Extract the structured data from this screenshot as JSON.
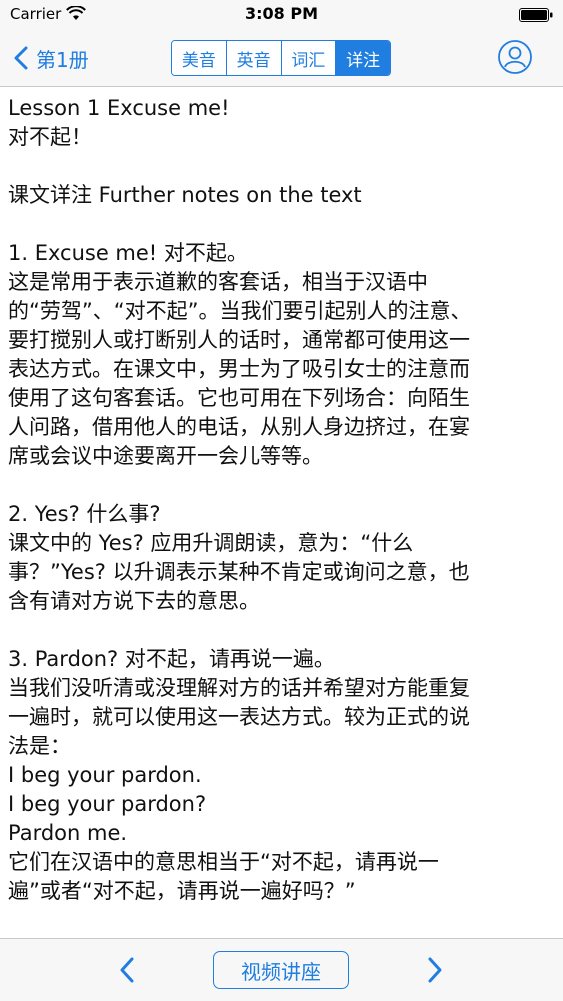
{
  "status_bar": {
    "carrier": "Carrier",
    "time": "3:08 PM"
  },
  "nav": {
    "back_label": "第1册",
    "segments": [
      "美音",
      "英音",
      "词汇",
      "详注"
    ],
    "active_segment": "详注",
    "accent_color": "#1f7ee0"
  },
  "content": {
    "title_en": "Lesson 1 Excuse me!",
    "title_zh": "对不起！",
    "section_heading": "课文详注 Further notes on the text",
    "notes": [
      {
        "heading": "1. Excuse me! 对不起。",
        "body": [
          "这是常用于表示道歉的客套话，相当于汉语中",
          "的“劳驾”、“对不起”。当我们要引起别人的注意、",
          "要打搅别人或打断别人的话时，通常都可使用这一",
          "表达方式。在课文中，男士为了吸引女士的注意而",
          "使用了这句客套话。它也可用在下列场合：向陌生",
          "人问路，借用他人的电话，从别人身边挤过，在宴",
          "席或会议中途要离开一会儿等等。"
        ]
      },
      {
        "heading": "2. Yes? 什么事?",
        "body": [
          "课文中的 Yes? 应用升调朗读，意为：“什么",
          "事？”Yes? 以升调表示某种不肯定或询问之意，也",
          "含有请对方说下去的意思。"
        ]
      },
      {
        "heading": "3. Pardon? 对不起，请再说一遍。",
        "body": [
          "当我们没听清或没理解对方的话并希望对方能重复",
          "一遍时，就可以使用这一表达方式。较为正式的说",
          "法是：",
          "I beg your pardon.",
          "I beg your pardon?",
          "Pardon me.",
          "它们在汉语中的意思相当于“对不起，请再说一",
          "遍”或者“对不起，请再说一遍好吗？”"
        ]
      }
    ]
  },
  "toolbar": {
    "video_label": "视频讲座"
  }
}
